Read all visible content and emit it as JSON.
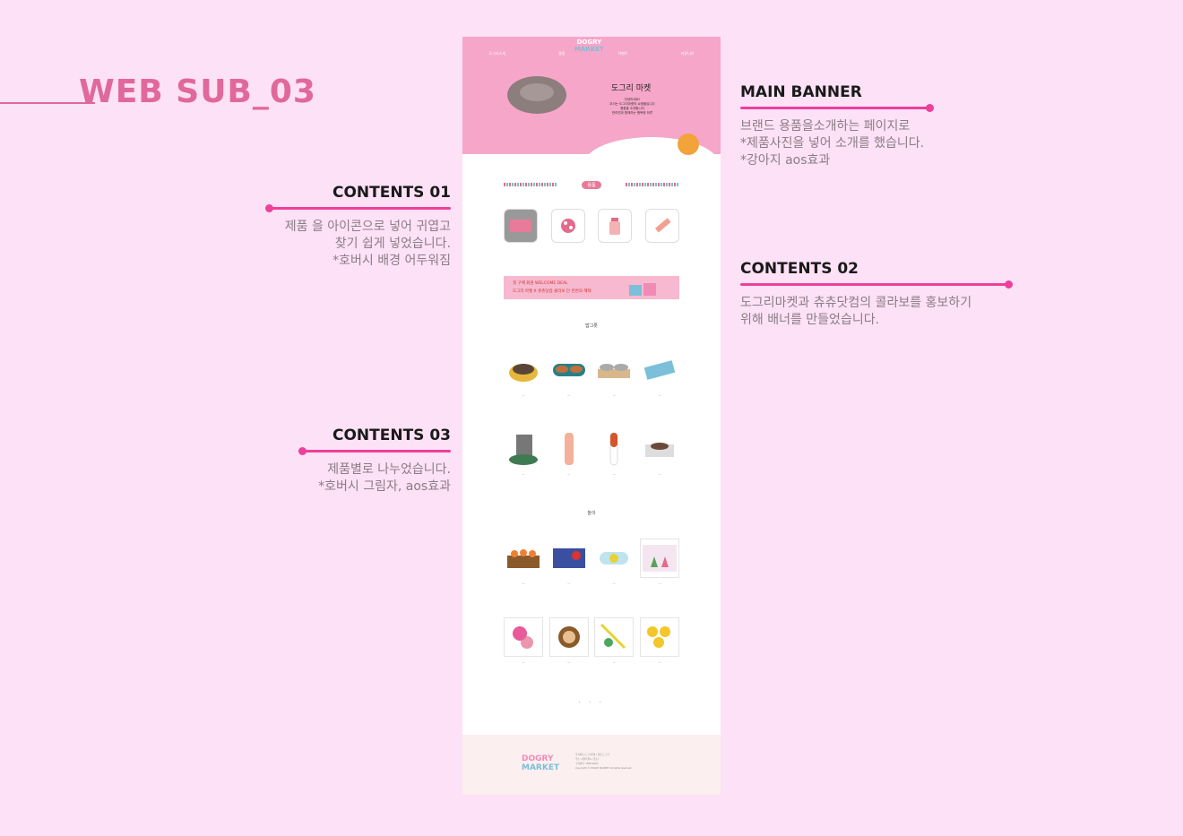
{
  "page_title": "WEB SUB_03",
  "annotations": {
    "main_banner": {
      "heading": "MAIN BANNER",
      "lines": [
        "브랜드 용품을소개하는 페이지로",
        "*제품사진을 넣어 소개를 했습니다.",
        "*강아지 aos효과"
      ]
    },
    "contents_01": {
      "heading": "CONTENTS 01",
      "lines": [
        "제품 을 아이콘으로 넣어 귀엽고",
        "찾기 쉽게 넣었습니다.",
        "*호버시 배경 어두워짐"
      ]
    },
    "contents_02": {
      "heading": "CONTENTS 02",
      "lines": [
        "도그리마켓과 츄츄닷컴의 콜라보를 홍보하기",
        "위해 배너를 만들었습니다."
      ]
    },
    "contents_03": {
      "heading": "CONTENTS 03",
      "lines": [
        "제품별로 나누었습니다.",
        "*호버시 그림자, aos효과"
      ]
    }
  },
  "site": {
    "logo_top": "DOGRY",
    "logo_bottom": "MARKET",
    "nav": [
      "도그리소개",
      "용품",
      "이벤트",
      "커뮤니티"
    ],
    "banner_title": "도그리 마켓",
    "banner_text": [
      "안녕하세요!",
      "우리는 도그리마켓의 쇼핑몰입니다",
      "용품을 소개합니다",
      "반려견과 함께하는 행복한 하루"
    ],
    "section_pill": "용품",
    "promo_line1": "첫 구매 회원 WELCOME DEAL",
    "promo_line2": "도그리 마켓 X 츄츄닷컴 콜라보 단 한번의 혜택",
    "category_1": "밥그릇",
    "category_2": "놀이",
    "pager": "• • •",
    "footer_text": [
      "주식회사 도그리마켓 | 대표 도그리",
      "주소: 서울특별시 강남구",
      "고객센터: 1588-0000",
      "Copyright © DOGRY MARKET All rights reserved."
    ]
  }
}
